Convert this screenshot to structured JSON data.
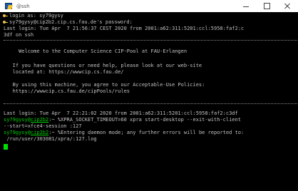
{
  "window": {
    "title": "@ssh"
  },
  "lines": {
    "l0": "login as: sy79gysy",
    "l1": "sy79gysy@cip2b2.cip.cs.fau.de's password:",
    "l2": "Last login: Tue Apr  7 21:56:37 CEST 2020 from 2001:a62:311:5201:ccl:5958:faf2:c",
    "l3": "3df on ssh",
    "w1": "     Welcome to the Computer Science CIP-Pool at FAU-Erlangen",
    "h1": "   If you have questions or need help, please look at our web-site",
    "h2": "   located at: https://wwwcip.cs.fau.de/",
    "p1": "   By using this machine, you agree to our Acceptable-Use Policies:",
    "p2": "   https://wwwcip.cs.fau.de/cipPools/rules",
    "ll": "Last login: Tue Apr  7 22:21:02 2020 from 2001:a62:311:5201:ccl:5958:faf2:c3df",
    "c1_user": "sy79gysy@",
    "c1_host": "cip2b2",
    "c1_rest": ":~ %XPRA_SOCKET_TIMEOUT=60 xpra start-desktop --exit-with-client",
    "c1_cont": "--start=xfce4-session :127",
    "c2_user": "sy79gysy@",
    "c2_host": "cip2b2",
    "c2_rest": ":~ %Entering daemon mode; any further errors will be reported to:",
    "c2_cont": " /run/user/303081/xpra/:127.log"
  },
  "colors": {
    "background": "#000000",
    "text": "#c0c0c0",
    "prompt": "#00d000",
    "cursor": "#00e000"
  },
  "icons": {
    "app": "putty-icon",
    "login_key": "key-icon"
  }
}
